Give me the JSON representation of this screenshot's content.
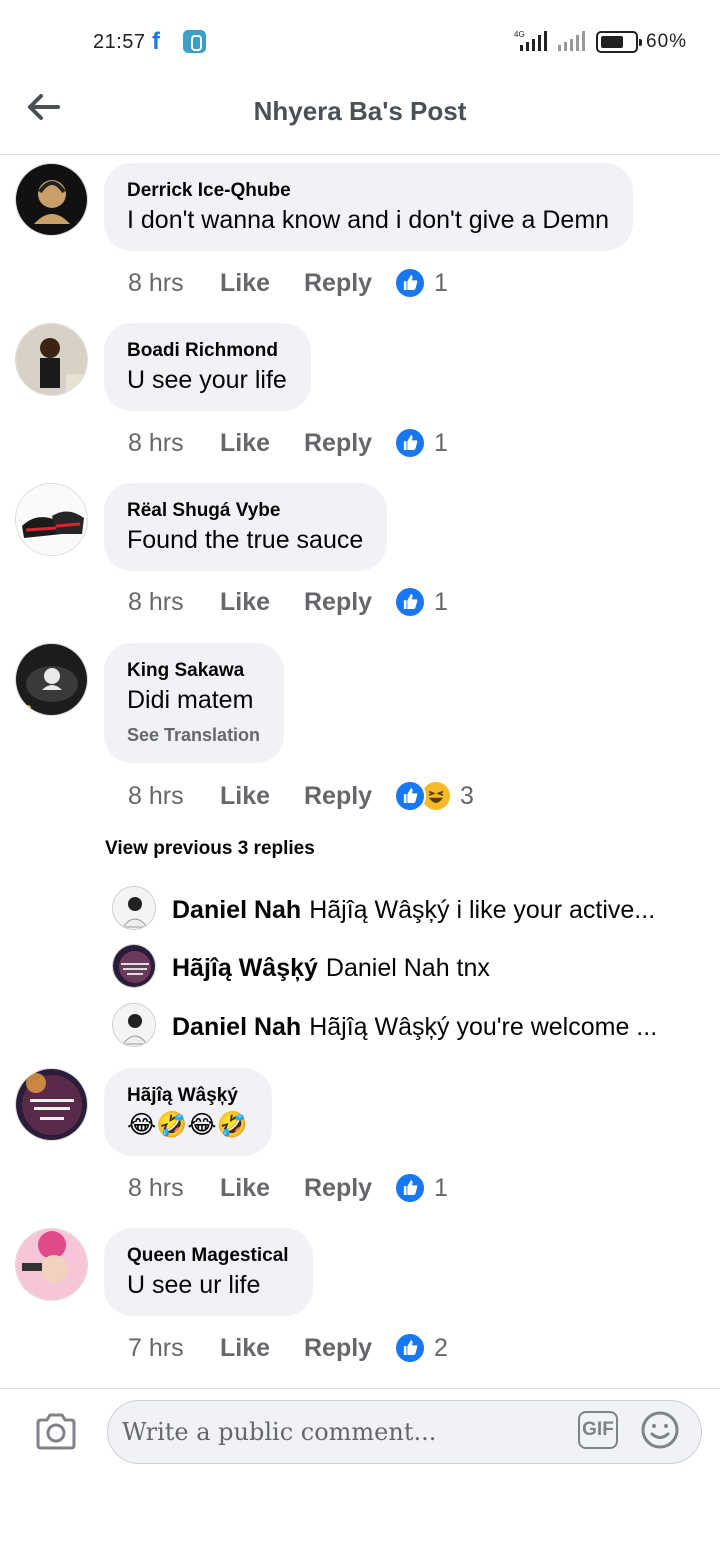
{
  "status_bar": {
    "time": "21:57",
    "battery_percent": "60%",
    "network": "4G",
    "fb_glyph": "f"
  },
  "header": {
    "title": "Nhyera Ba's Post"
  },
  "comments": [
    {
      "author": "Derrick Ice-Qhube",
      "text": "I don't wanna know and i don't give a Demn",
      "time": "8 hrs",
      "like_label": "Like",
      "reply_label": "Reply",
      "reaction_count": "1",
      "reactions": [
        "like"
      ]
    },
    {
      "author": "Boadi Richmond",
      "text": "U see your life",
      "time": "8 hrs",
      "like_label": "Like",
      "reply_label": "Reply",
      "reaction_count": "1",
      "reactions": [
        "like"
      ]
    },
    {
      "author": "Rëal Shugá Vybe",
      "text": "Found the true sauce",
      "time": "8 hrs",
      "like_label": "Like",
      "reply_label": "Reply",
      "reaction_count": "1",
      "reactions": [
        "like"
      ]
    },
    {
      "author": "King Sakawa",
      "text": "Didi matem",
      "translate_label": "See Translation",
      "time": "8 hrs",
      "like_label": "Like",
      "reply_label": "Reply",
      "reaction_count": "3",
      "reactions": [
        "like",
        "haha"
      ]
    },
    {
      "author": "Hãjîą Wâşķý",
      "text": "😂🤣😂🤣",
      "time": "8 hrs",
      "like_label": "Like",
      "reply_label": "Reply",
      "reaction_count": "1",
      "reactions": [
        "like"
      ]
    },
    {
      "author": "Queen Magestical",
      "text": "U see ur life",
      "time": "7 hrs",
      "like_label": "Like",
      "reply_label": "Reply",
      "reaction_count": "2",
      "reactions": [
        "like"
      ]
    }
  ],
  "replies": {
    "view_previous_label": "View previous 3 replies",
    "items": [
      {
        "author": "Daniel Nah",
        "text": "Hãjîą Wâşķý i like your active..."
      },
      {
        "author": "Hãjîą Wâşķý",
        "text": "Daniel Nah tnx"
      },
      {
        "author": "Daniel Nah",
        "text": "Hãjîą Wâşķý you're welcome ..."
      }
    ]
  },
  "composer": {
    "placeholder": "Write a public comment...",
    "gif_label": "GIF"
  },
  "colors": {
    "accent": "#1877f2",
    "bubble": "#f0f2f5",
    "muted": "#65676b",
    "haha": "#f7b928"
  },
  "icons": [
    "back-arrow-icon",
    "facebook-icon",
    "app-icon",
    "signal-icon",
    "battery-icon",
    "like-reaction-icon",
    "haha-reaction-icon",
    "camera-icon",
    "gif-icon",
    "emoji-icon"
  ]
}
